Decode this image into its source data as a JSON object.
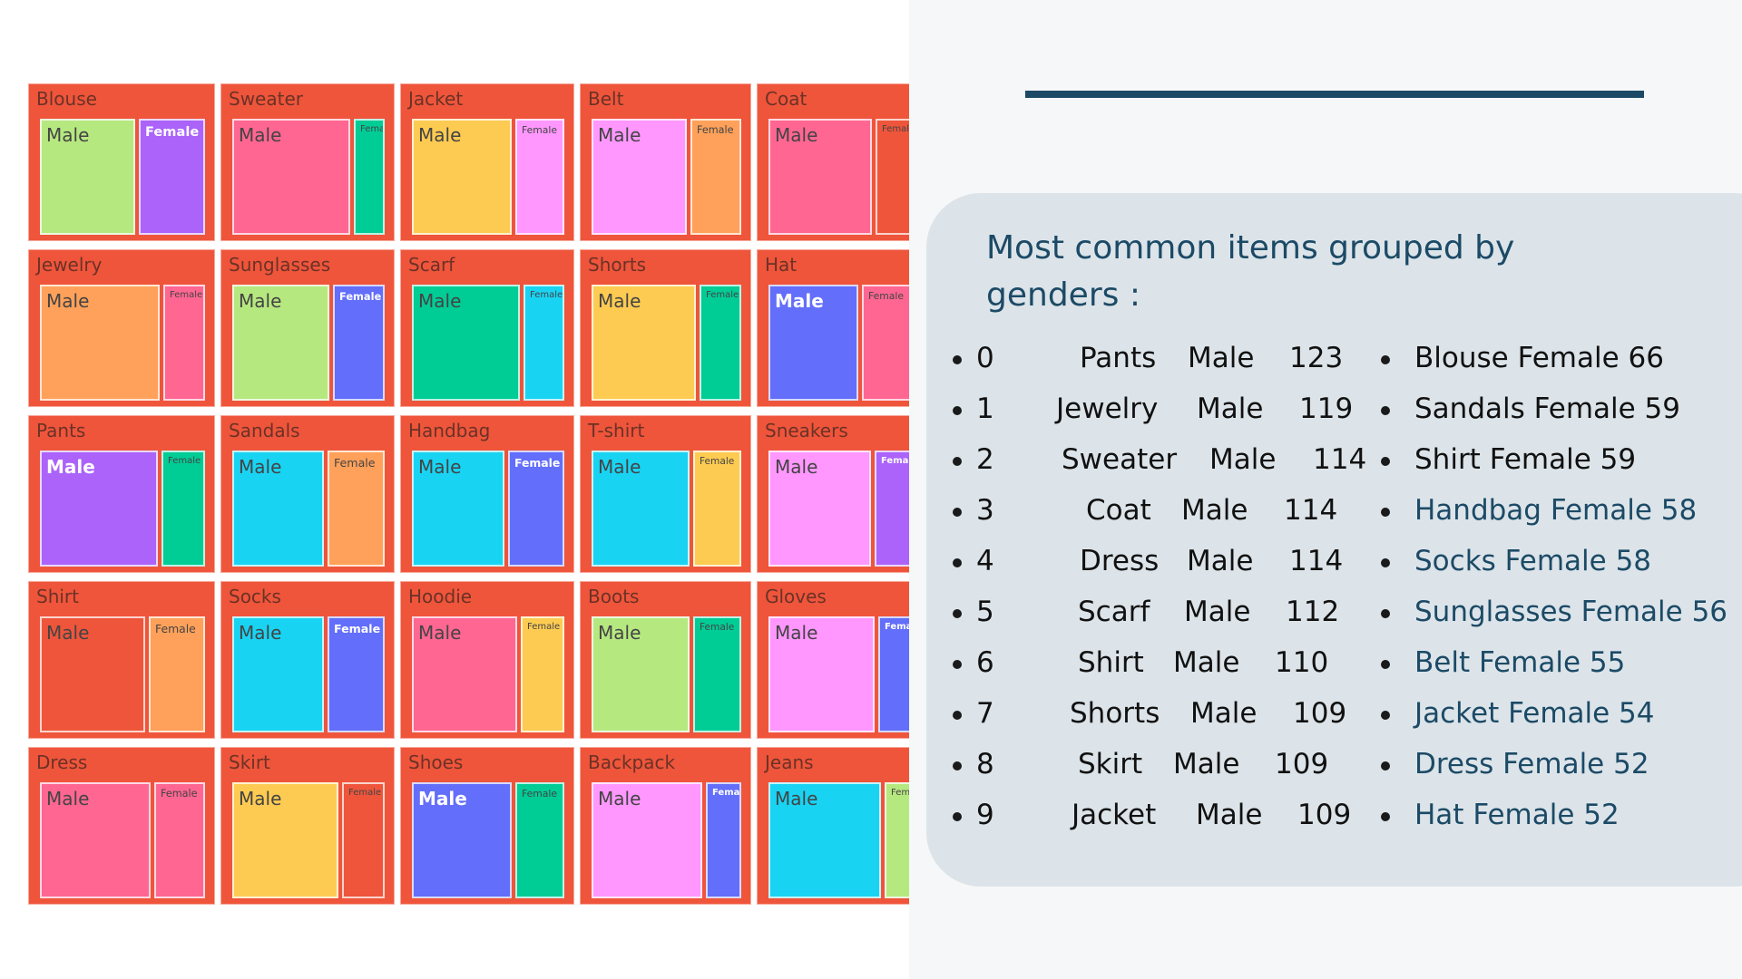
{
  "chart_data": {
    "type": "treemap",
    "categories": [
      "Blouse",
      "Sweater",
      "Jacket",
      "Belt",
      "Coat",
      "Jewelry",
      "Sunglasses",
      "Scarf",
      "Shorts",
      "Hat",
      "Pants",
      "Sandals",
      "Handbag",
      "T-shirt",
      "Sneakers",
      "Shirt",
      "Socks",
      "Hoodie",
      "Boots",
      "Gloves",
      "Dress",
      "Skirt",
      "Shoes",
      "Backpack",
      "Jeans"
    ],
    "series": [
      {
        "name": "Male",
        "values": [
          95,
          108,
          109,
          104,
          114,
          119,
          104,
          112,
          109,
          95,
          123,
          95,
          95,
          96,
          105,
          110,
          94,
          100,
          96,
          102,
          114,
          109,
          95,
          100,
          97
        ]
      },
      {
        "name": "Female",
        "values": [
          66,
          28,
          54,
          55,
          39,
          41,
          56,
          43,
          44,
          52,
          45,
          59,
          58,
          47,
          37,
          59,
          58,
          41,
          47,
          31,
          52,
          44,
          46,
          32,
          23
        ]
      }
    ],
    "colors": {
      "outer": "#ef553b",
      "Blouse": {
        "Male": "#b6e880",
        "Female": "#ab63fa"
      },
      "Sweater": {
        "Male": "#ff6692",
        "Female": "#00cc96"
      },
      "Jacket": {
        "Male": "#fecb52",
        "Female": "#ff97ff"
      },
      "Belt": {
        "Male": "#ff97ff",
        "Female": "#ffa15a"
      },
      "Coat": {
        "Male": "#ff6692",
        "Female": "#ef553b"
      },
      "Jewelry": {
        "Male": "#ffa15a",
        "Female": "#ff6692"
      },
      "Sunglasses": {
        "Male": "#b6e880",
        "Female": "#636efa"
      },
      "Scarf": {
        "Male": "#00cc96",
        "Female": "#19d3f3"
      },
      "Shorts": {
        "Male": "#fecb52",
        "Female": "#00cc96"
      },
      "Hat": {
        "Male": "#636efa",
        "Female": "#ff6692"
      },
      "Pants": {
        "Male": "#ab63fa",
        "Female": "#00cc96"
      },
      "Sandals": {
        "Male": "#19d3f3",
        "Female": "#ffa15a"
      },
      "Handbag": {
        "Male": "#19d3f3",
        "Female": "#636efa"
      },
      "T-shirt": {
        "Male": "#19d3f3",
        "Female": "#fecb52"
      },
      "Sneakers": {
        "Male": "#ff97ff",
        "Female": "#ab63fa"
      },
      "Shirt": {
        "Male": "#ef553b",
        "Female": "#ffa15a"
      },
      "Socks": {
        "Male": "#19d3f3",
        "Female": "#636efa"
      },
      "Hoodie": {
        "Male": "#ff6692",
        "Female": "#fecb52"
      },
      "Boots": {
        "Male": "#b6e880",
        "Female": "#00cc96"
      },
      "Gloves": {
        "Male": "#ff97ff",
        "Female": "#636efa"
      },
      "Dress": {
        "Male": "#ff6692",
        "Female": "#ff6692"
      },
      "Skirt": {
        "Male": "#fecb52",
        "Female": "#ef553b"
      },
      "Shoes": {
        "Male": "#636efa",
        "Female": "#00cc96"
      },
      "Backpack": {
        "Male": "#ff97ff",
        "Female": "#636efa"
      },
      "Jeans": {
        "Male": "#19d3f3",
        "Female": "#b6e880"
      }
    }
  },
  "summary": {
    "title": "Most common items grouped by genders :",
    "male_rows": [
      {
        "index": "0",
        "item": "Pants",
        "gender": "Male",
        "count": "123"
      },
      {
        "index": "1",
        "item": "Jewelry",
        "gender": "Male",
        "count": "119"
      },
      {
        "index": "2",
        "item": "Sweater",
        "gender": "Male",
        "count": "114"
      },
      {
        "index": "3",
        "item": "Coat",
        "gender": "Male",
        "count": "114"
      },
      {
        "index": "4",
        "item": "Dress",
        "gender": "Male",
        "count": "114"
      },
      {
        "index": "5",
        "item": "Scarf",
        "gender": "Male",
        "count": "112"
      },
      {
        "index": "6",
        "item": "Shirt",
        "gender": "Male",
        "count": "110"
      },
      {
        "index": "7",
        "item": "Shorts",
        "gender": "Male",
        "count": "109"
      },
      {
        "index": "8",
        "item": "Skirt",
        "gender": "Male",
        "count": "109"
      },
      {
        "index": "9",
        "item": "Jacket",
        "gender": "Male",
        "count": "109"
      }
    ],
    "female_rows": [
      "Blouse Female 66",
      "Sandals Female 59",
      "Shirt Female 59",
      "Handbag Female 58",
      "Socks Female 58",
      "Sunglasses Female 56",
      "Belt Female 55",
      "Jacket Female 54",
      "Dress Female 52",
      "Hat Female 52"
    ],
    "accent": "#1c4a66"
  }
}
